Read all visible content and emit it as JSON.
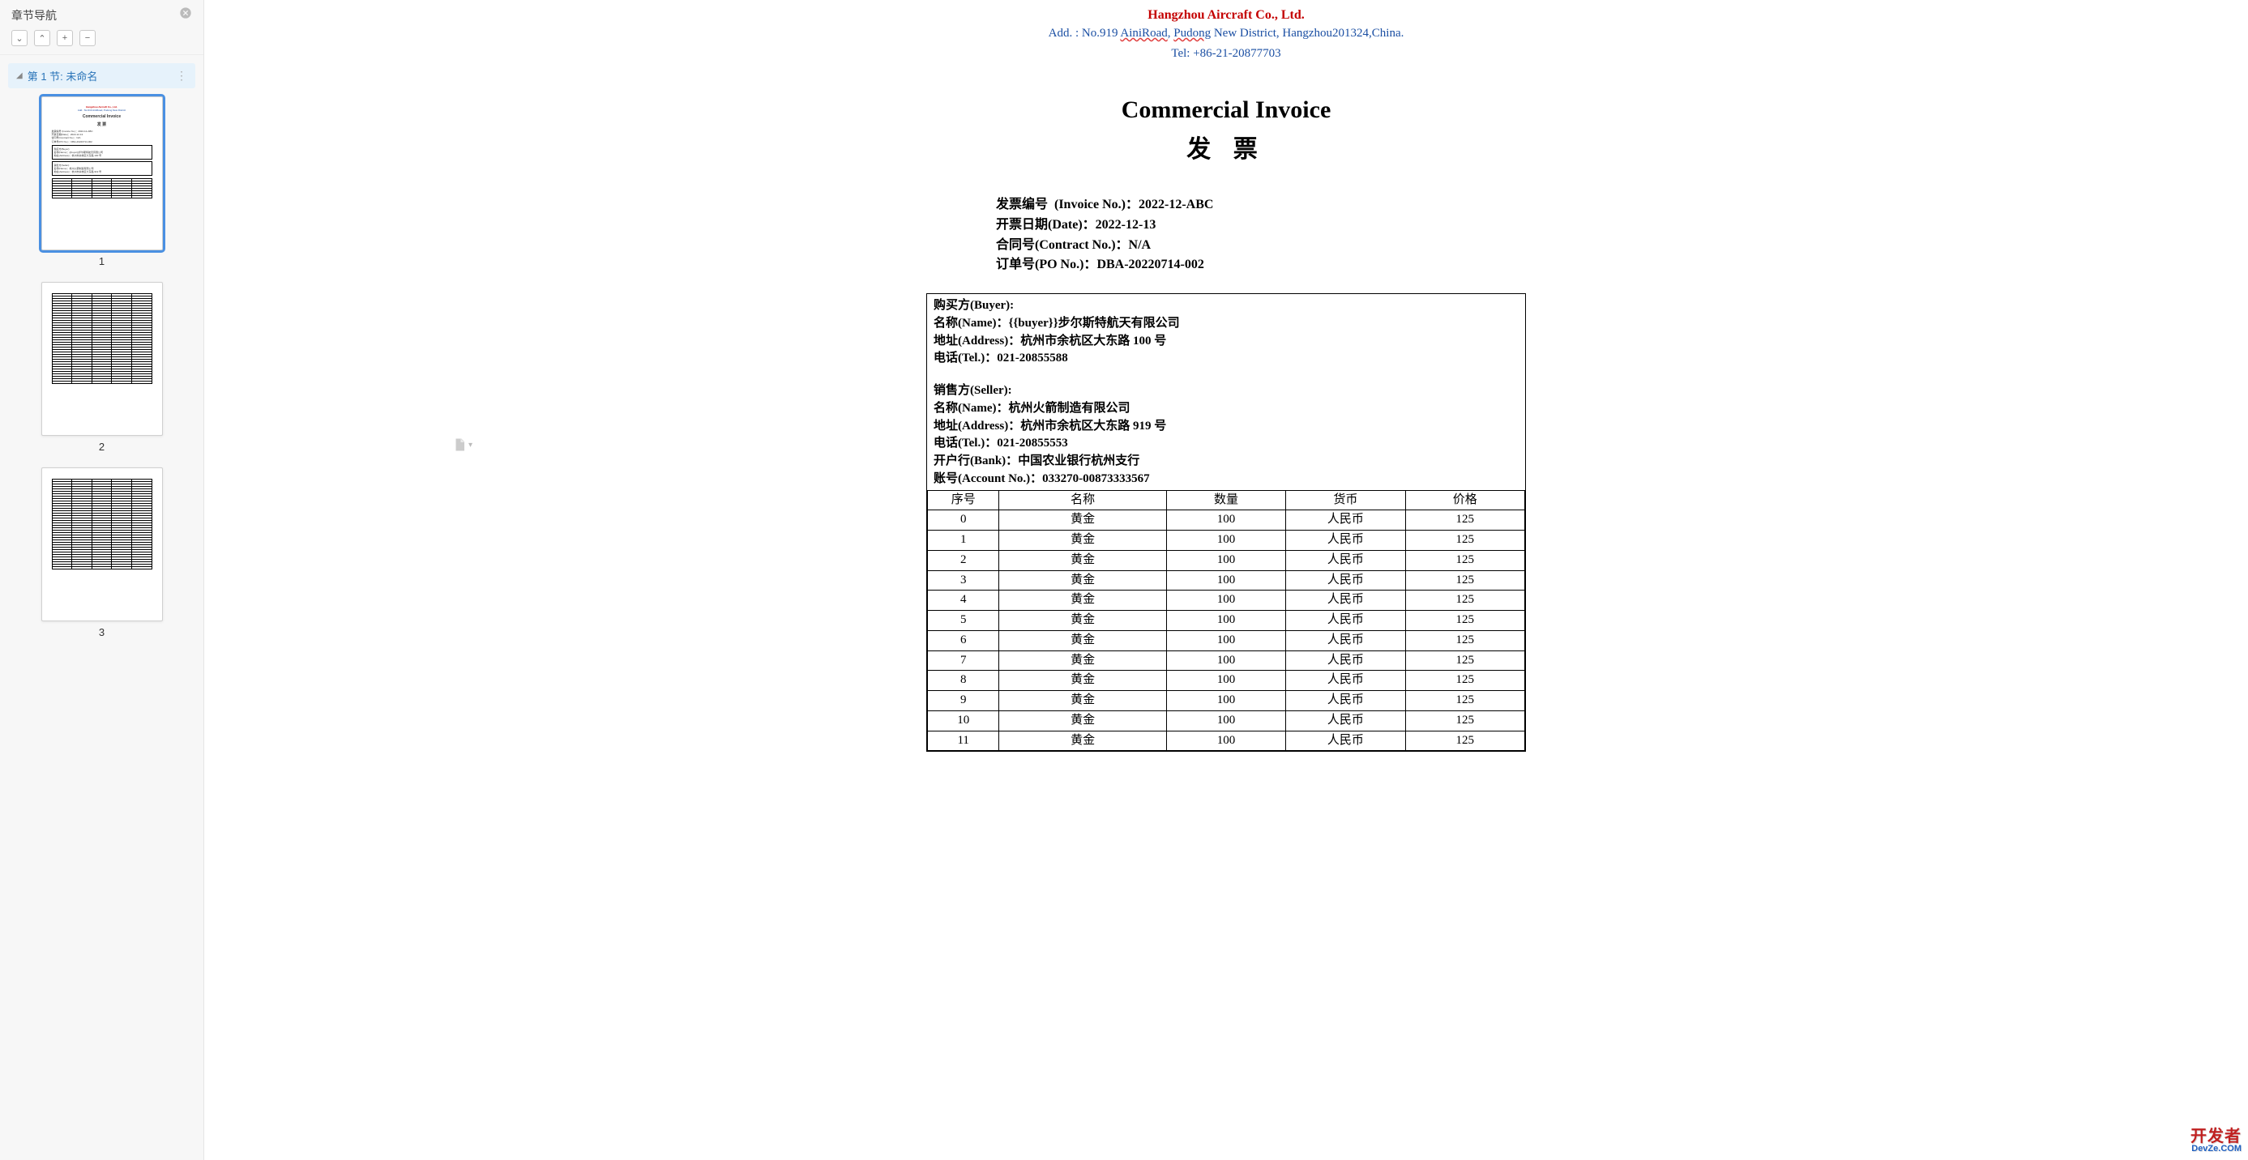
{
  "sidebar": {
    "title": "章节导航",
    "toolbar": {
      "expand": "⌄",
      "collapse": "⌃",
      "add": "+",
      "remove": "−"
    },
    "section": {
      "caret": "◢",
      "label": "第 1 节: 未命名",
      "more": "⋮"
    },
    "thumbs": [
      {
        "num": "1",
        "selected": true
      },
      {
        "num": "2",
        "selected": false
      },
      {
        "num": "3",
        "selected": false
      }
    ]
  },
  "header": {
    "company_red": "Hangzhou Aircraft Co., Ltd.",
    "addr_blue_prefix": "Add. : No.919 ",
    "addr_blue_u1": "AiniRoad",
    "addr_blue_mid": ", ",
    "addr_blue_u2": "Pudong",
    "addr_blue_suffix": " New District, Hangzhou201324,China.",
    "tel_blue": "Tel: +86-21-20877703"
  },
  "doc": {
    "title_en": "Commercial Invoice",
    "title_cn": "发  票"
  },
  "info": {
    "invoice_no": {
      "label": "发票编号  (Invoice No.)：",
      "value": "2022-12-ABC"
    },
    "date": {
      "label": "开票日期(Date)：",
      "value": "2022-12-13"
    },
    "contract": {
      "label": "合同号(Contract No.)：",
      "value": "N/A"
    },
    "po": {
      "label": "订单号(PO No.)：",
      "value": "DBA-20220714-002"
    }
  },
  "buyer": {
    "heading": "购买方(Buyer):",
    "name_label": "名称(Name)：",
    "name_value": "{{buyer}}步尔斯特航天有限公司",
    "addr_label": "地址(Address)：",
    "addr_value": "杭州市余杭区大东路 100 号",
    "tel_label": "电话(Tel.)：",
    "tel_value": "021-20855588"
  },
  "seller": {
    "heading": "销售方(Seller):",
    "name_label": "名称(Name)：",
    "name_value": "杭州火箭制造有限公司",
    "addr_label": "地址(Address)：",
    "addr_value": "杭州市余杭区大东路 919 号",
    "tel_label": "电话(Tel.)：",
    "tel_value": "021-20855553",
    "bank_label": "开户行(Bank)：",
    "bank_value": "中国农业银行杭州支行",
    "acct_label": "账号(Account No.)：",
    "acct_value": "033270-00873333567"
  },
  "table": {
    "headers": [
      "序号",
      "名称",
      "数量",
      "货币",
      "价格"
    ],
    "rows": [
      {
        "idx": "0",
        "name": "黄金",
        "qty": "100",
        "ccy": "人民币",
        "price": "125"
      },
      {
        "idx": "1",
        "name": "黄金",
        "qty": "100",
        "ccy": "人民币",
        "price": "125"
      },
      {
        "idx": "2",
        "name": "黄金",
        "qty": "100",
        "ccy": "人民币",
        "price": "125"
      },
      {
        "idx": "3",
        "name": "黄金",
        "qty": "100",
        "ccy": "人民币",
        "price": "125"
      },
      {
        "idx": "4",
        "name": "黄金",
        "qty": "100",
        "ccy": "人民币",
        "price": "125"
      },
      {
        "idx": "5",
        "name": "黄金",
        "qty": "100",
        "ccy": "人民币",
        "price": "125"
      },
      {
        "idx": "6",
        "name": "黄金",
        "qty": "100",
        "ccy": "人民币",
        "price": "125"
      },
      {
        "idx": "7",
        "name": "黄金",
        "qty": "100",
        "ccy": "人民币",
        "price": "125"
      },
      {
        "idx": "8",
        "name": "黄金",
        "qty": "100",
        "ccy": "人民币",
        "price": "125"
      },
      {
        "idx": "9",
        "name": "黄金",
        "qty": "100",
        "ccy": "人民币",
        "price": "125"
      },
      {
        "idx": "10",
        "name": "黄金",
        "qty": "100",
        "ccy": "人民币",
        "price": "125"
      },
      {
        "idx": "11",
        "name": "黄金",
        "qty": "100",
        "ccy": "人民币",
        "price": "125"
      }
    ]
  },
  "watermark": {
    "line1": "开发者",
    "line2": "DevZe.COM"
  }
}
